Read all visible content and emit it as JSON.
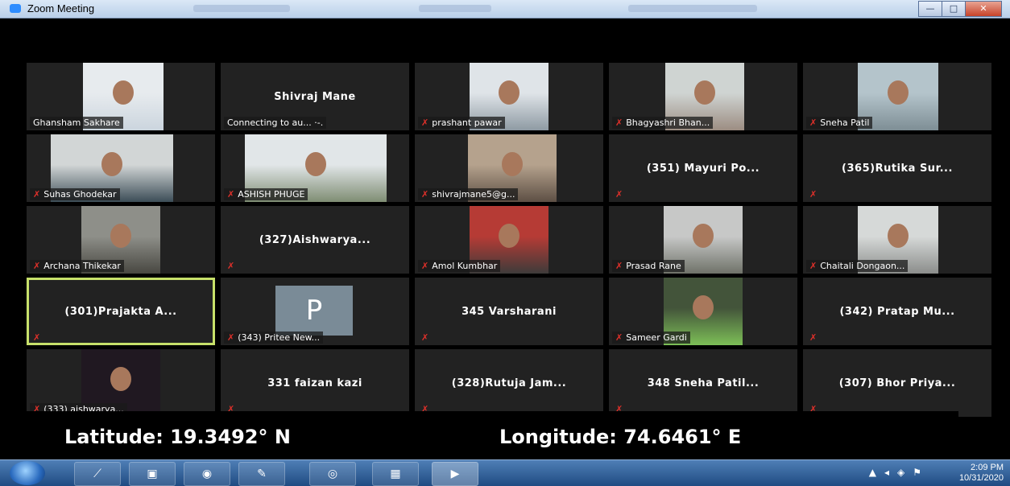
{
  "window": {
    "title": "Zoom Meeting",
    "min": "—",
    "max": "□",
    "close": "✕"
  },
  "participants": [
    [
      "Ghansham Sakhare",
      "",
      false,
      "video"
    ],
    [
      "Connecting to au... ·-.",
      "Shivraj Mane",
      false,
      "name"
    ],
    [
      "prashant pawar",
      "",
      true,
      "video"
    ],
    [
      "Bhagyashri Bhan...",
      "",
      true,
      "video"
    ],
    [
      "Sneha Patil",
      "",
      true,
      "video"
    ],
    [
      "Suhas Ghodekar",
      "",
      true,
      "video"
    ],
    [
      "ASHISH PHUGE",
      "",
      true,
      "video"
    ],
    [
      "shivrajmane5@g...",
      "",
      true,
      "video"
    ],
    [
      "",
      "(351) Mayuri Po...",
      true,
      "name"
    ],
    [
      "",
      "(365)Rutika Sur...",
      true,
      "name"
    ],
    [
      "Archana Thikekar",
      "",
      true,
      "video"
    ],
    [
      "",
      "(327)Aishwarya...",
      true,
      "name"
    ],
    [
      "Amol Kumbhar",
      "",
      true,
      "video"
    ],
    [
      "Prasad Rane",
      "",
      true,
      "video"
    ],
    [
      "Chaitali Dongaon...",
      "",
      true,
      "video"
    ],
    [
      "",
      "(301)Prajakta A...",
      true,
      "name"
    ],
    [
      "(343) Pritee New...",
      "P",
      true,
      "avatar"
    ],
    [
      "",
      "345 Varsharani",
      true,
      "name"
    ],
    [
      "Sameer Gardi",
      "",
      true,
      "video"
    ],
    [
      "",
      "(342) Pratap Mu...",
      true,
      "name"
    ],
    [
      "(333) aishwarya...",
      "",
      true,
      "video"
    ],
    [
      "",
      "331 faizan kazi",
      true,
      "name"
    ],
    [
      "",
      "(328)Rutuja Jam...",
      true,
      "name"
    ],
    [
      "",
      "348 Sneha Patil...",
      true,
      "name"
    ],
    [
      "",
      "(307) Bhor Priya...",
      true,
      "name"
    ]
  ],
  "active_index": 15,
  "overlay": {
    "latitude": "Latitude: 19.3492° N",
    "longitude": "Longitude: 74.6461° E"
  },
  "taskbar": {
    "time": "2:09 PM",
    "date": "10/31/2020"
  },
  "colors": {
    "tile": "#222222",
    "active_outline": "#c7e06a",
    "mute": "#e0302a"
  }
}
